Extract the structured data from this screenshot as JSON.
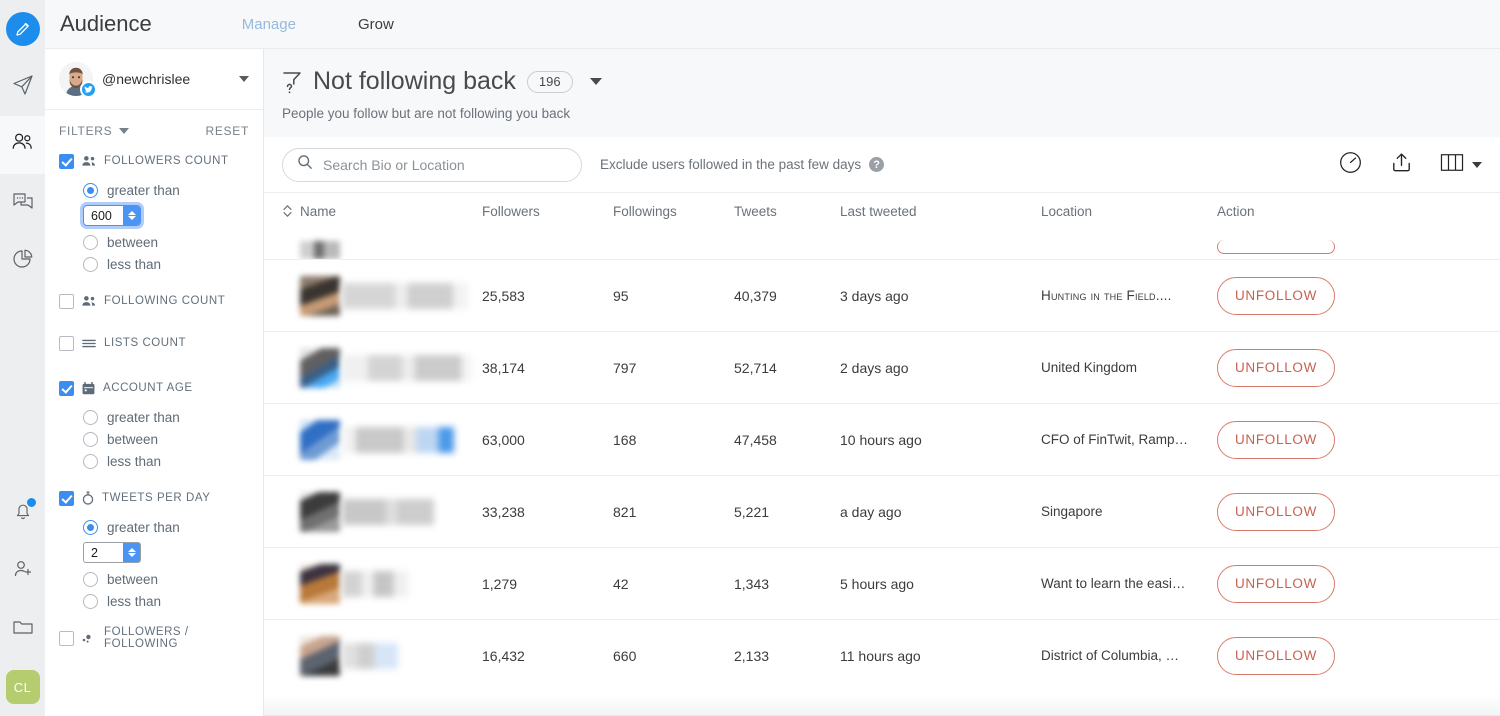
{
  "rail": {
    "items": [
      {
        "name": "compose-button",
        "icon": "pencil-icon"
      },
      {
        "name": "publish-button",
        "icon": "paper-plane-icon"
      },
      {
        "name": "audience-button",
        "icon": "people-icon",
        "active": true
      },
      {
        "name": "inbox-button",
        "icon": "chat-bubbles-icon"
      },
      {
        "name": "analytics-button",
        "icon": "pie-chart-icon"
      },
      {
        "name": "notifications-button",
        "icon": "bell-icon",
        "badge": true
      },
      {
        "name": "add-user-button",
        "icon": "user-plus-icon"
      },
      {
        "name": "files-button",
        "icon": "folder-icon"
      }
    ],
    "user_avatar_initials": "CL"
  },
  "topbar": {
    "app_title": "Audience",
    "tabs": [
      {
        "label": "Manage",
        "active": true
      },
      {
        "label": "Grow",
        "active": false
      }
    ]
  },
  "account": {
    "handle": "@newchrislee",
    "network_badge": "twitter-icon"
  },
  "filters_panel": {
    "filters_label": "FILTERS",
    "reset_label": "RESET",
    "groups": [
      {
        "title": "FOLLOWERS COUNT",
        "icon": "people-icon",
        "checked": true,
        "options": [
          {
            "label": "greater than",
            "selected": true
          },
          {
            "label": "between",
            "selected": false
          },
          {
            "label": "less than",
            "selected": false
          }
        ],
        "value": "600",
        "value_focused": true
      },
      {
        "title": "FOLLOWING COUNT",
        "icon": "people-icon",
        "checked": false,
        "options": [],
        "value": null
      },
      {
        "title": "LISTS COUNT",
        "icon": "list-icon",
        "checked": false,
        "options": [],
        "value": null
      },
      {
        "title": "ACCOUNT AGE",
        "icon": "calendar-icon",
        "checked": true,
        "options": [
          {
            "label": "greater than",
            "selected": false
          },
          {
            "label": "between",
            "selected": false
          },
          {
            "label": "less than",
            "selected": false
          }
        ],
        "value": null
      },
      {
        "title": "TWEETS PER DAY",
        "icon": "stopwatch-icon",
        "checked": true,
        "options": [
          {
            "label": "greater than",
            "selected": true
          },
          {
            "label": "between",
            "selected": false
          },
          {
            "label": "less than",
            "selected": false
          }
        ],
        "value": "2",
        "value_focused": false
      },
      {
        "title": "FOLLOWERS / FOLLOWING",
        "icon": "ratio-icon",
        "checked": false,
        "options": [],
        "value": null
      }
    ]
  },
  "main": {
    "header": {
      "icon": "filter-question-icon",
      "title": "Not following back",
      "count": "196",
      "dropdown_icon": "caret-down-icon",
      "subtitle": "People you follow but are not following you back"
    },
    "toolbar": {
      "search_placeholder": "Search Bio or Location",
      "search_value": "",
      "search_icon": "search-icon",
      "exclude_label": "Exclude users followed in the past few days",
      "help_icon": "question-mark-icon",
      "speed_icon": "gauge-icon",
      "export_icon": "upload-icon",
      "columns_icon": "columns-icon",
      "columns_caret": "caret-down-icon"
    },
    "table": {
      "sort_icon": "sort-icon",
      "columns": [
        "Name",
        "Followers",
        "Followings",
        "Tweets",
        "Last tweeted",
        "Location",
        "Action"
      ],
      "action_label": "UNFOLLOW",
      "rows": [
        {
          "name": "",
          "followers": "25,583",
          "followings": "95",
          "tweets": "40,379",
          "last_tweeted": "3 days ago",
          "location": "Hunting in the Field....",
          "location_smallcaps": true,
          "action": "UNFOLLOW"
        },
        {
          "name": "",
          "followers": "38,174",
          "followings": "797",
          "tweets": "52,714",
          "last_tweeted": "2 days ago",
          "location": "United Kingdom",
          "location_smallcaps": false,
          "action": "UNFOLLOW"
        },
        {
          "name": "",
          "followers": "63,000",
          "followings": "168",
          "tweets": "47,458",
          "last_tweeted": "10 hours ago",
          "location": "CFO of FinTwit, Ramp…",
          "location_smallcaps": false,
          "action": "UNFOLLOW"
        },
        {
          "name": "",
          "followers": "33,238",
          "followings": "821",
          "tweets": "5,221",
          "last_tweeted": "a day ago",
          "location": "Singapore",
          "location_smallcaps": false,
          "action": "UNFOLLOW"
        },
        {
          "name": "",
          "followers": "1,279",
          "followings": "42",
          "tweets": "1,343",
          "last_tweeted": "5 hours ago",
          "location": "Want to learn the easi…",
          "location_smallcaps": false,
          "action": "UNFOLLOW"
        },
        {
          "name": "",
          "followers": "16,432",
          "followings": "660",
          "tweets": "2,133",
          "last_tweeted": "11 hours ago",
          "location": "District of Columbia, …",
          "location_smallcaps": false,
          "action": "UNFOLLOW"
        }
      ]
    }
  },
  "colors": {
    "accent_blue": "#1d8ded",
    "tab_active": "#96b9dd",
    "unfollow_border": "#d97b6e",
    "unfollow_text": "#c9604f",
    "avatar_green": "#b5cc6f",
    "rail_bg": "#eceef0",
    "header_bg": "#f7f8f9"
  }
}
